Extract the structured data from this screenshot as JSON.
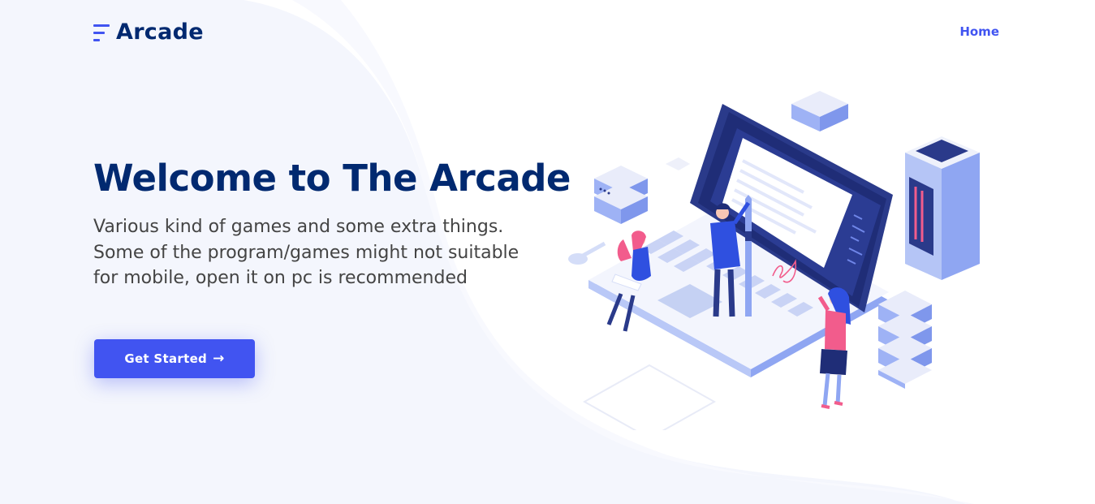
{
  "header": {
    "logo_text": "Arcade",
    "nav": {
      "home_label": "Home"
    }
  },
  "hero": {
    "title": "Welcome to The Arcade",
    "subtitle": "Various kind of games and some extra things. Some of the program/games might not suitable for mobile, open it on pc is recommended",
    "cta_label": "Get Started",
    "cta_icon": "arrow-right-icon"
  },
  "colors": {
    "primary": "#4154f1",
    "heading": "#012970",
    "text": "#444444",
    "background_wave": "#f4f6fd"
  },
  "illustration": {
    "signature_text": "Mf"
  }
}
